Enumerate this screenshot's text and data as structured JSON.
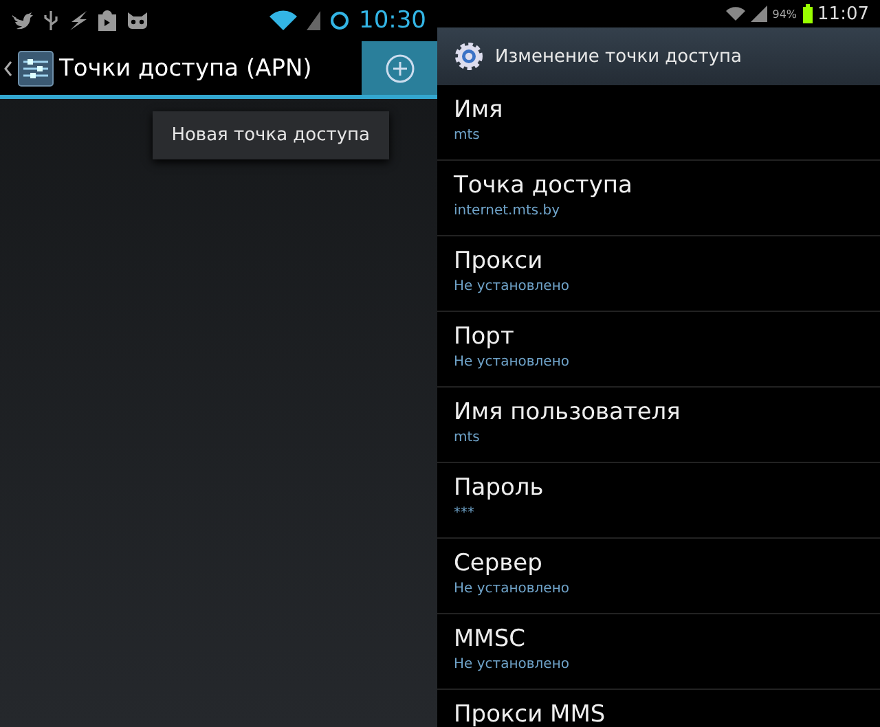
{
  "left_screen": {
    "status_bar": {
      "time": "10:30"
    },
    "action_bar": {
      "title": "Точки доступа (APN)"
    },
    "menu": {
      "items": [
        "Новая точка доступа"
      ]
    }
  },
  "right_screen": {
    "status_bar": {
      "battery": "94%",
      "time": "11:07"
    },
    "title_bar": {
      "title": "Изменение точки доступа"
    },
    "settings": [
      {
        "title": "Имя",
        "value": "mts"
      },
      {
        "title": "Точка доступа",
        "value": "internet.mts.by"
      },
      {
        "title": "Прокси",
        "value": "Не установлено"
      },
      {
        "title": "Порт",
        "value": "Не установлено"
      },
      {
        "title": "Имя пользователя",
        "value": "mts"
      },
      {
        "title": "Пароль",
        "value": "***"
      },
      {
        "title": "Сервер",
        "value": "Не установлено"
      },
      {
        "title": "MMSC",
        "value": "Не установлено"
      },
      {
        "title": "Прокси MMS"
      }
    ]
  }
}
